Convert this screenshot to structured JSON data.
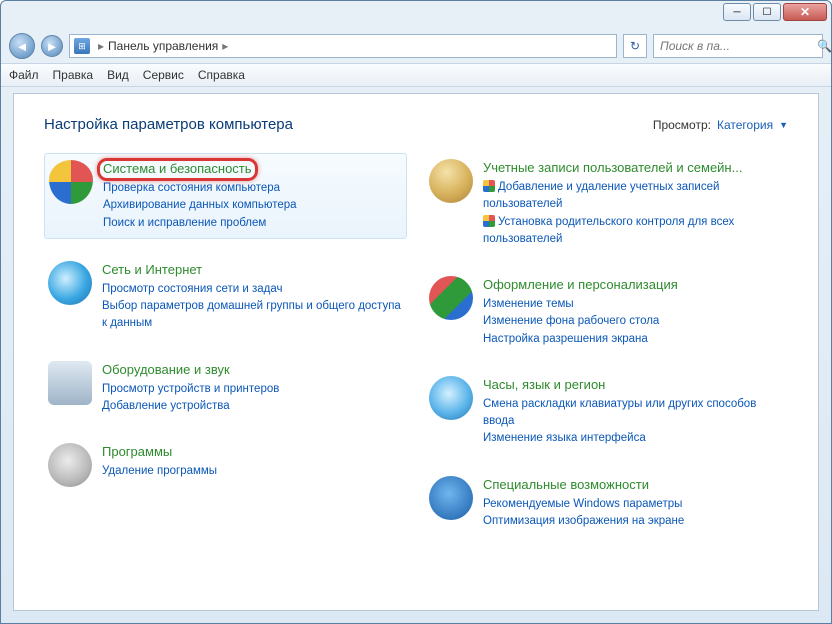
{
  "breadcrumb": {
    "label": "Панель управления",
    "sep": "▸"
  },
  "search": {
    "placeholder": "Поиск в па..."
  },
  "menu": {
    "file": "Файл",
    "edit": "Правка",
    "view": "Вид",
    "tools": "Сервис",
    "help": "Справка"
  },
  "heading": "Настройка параметров компьютера",
  "viewmode": {
    "label": "Просмотр:",
    "value": "Категория"
  },
  "left": [
    {
      "key": "system-security",
      "title": "Система и безопасность",
      "highlight": true,
      "boxed": true,
      "icon": "ic-shield",
      "links": [
        {
          "text": "Проверка состояния компьютера"
        },
        {
          "text": "Архивирование данных компьютера"
        },
        {
          "text": "Поиск и исправление проблем"
        }
      ]
    },
    {
      "key": "network",
      "title": "Сеть и Интернет",
      "icon": "ic-net",
      "links": [
        {
          "text": "Просмотр состояния сети и задач"
        },
        {
          "text": "Выбор параметров домашней группы и общего доступа к данным"
        }
      ]
    },
    {
      "key": "hardware",
      "title": "Оборудование и звук",
      "icon": "ic-hw",
      "links": [
        {
          "text": "Просмотр устройств и принтеров"
        },
        {
          "text": "Добавление устройства"
        }
      ]
    },
    {
      "key": "programs",
      "title": "Программы",
      "icon": "ic-prog",
      "links": [
        {
          "text": "Удаление программы"
        }
      ]
    }
  ],
  "right": [
    {
      "key": "users",
      "title": "Учетные записи пользователей и семейн...",
      "icon": "ic-users",
      "links": [
        {
          "text": "Добавление и удаление учетных записей пользователей",
          "shield": true
        },
        {
          "text": "Установка родительского контроля для всех пользователей",
          "shield": true
        }
      ]
    },
    {
      "key": "appearance",
      "title": "Оформление и персонализация",
      "icon": "ic-appear",
      "links": [
        {
          "text": "Изменение темы"
        },
        {
          "text": "Изменение фона рабочего стола"
        },
        {
          "text": "Настройка разрешения экрана"
        }
      ]
    },
    {
      "key": "clock",
      "title": "Часы, язык и регион",
      "icon": "ic-clock",
      "links": [
        {
          "text": "Смена раскладки клавиатуры или других способов ввода"
        },
        {
          "text": "Изменение языка интерфейса"
        }
      ]
    },
    {
      "key": "accessibility",
      "title": "Специальные возможности",
      "icon": "ic-access",
      "links": [
        {
          "text": "Рекомендуемые Windows параметры"
        },
        {
          "text": "Оптимизация изображения на экране"
        }
      ]
    }
  ]
}
